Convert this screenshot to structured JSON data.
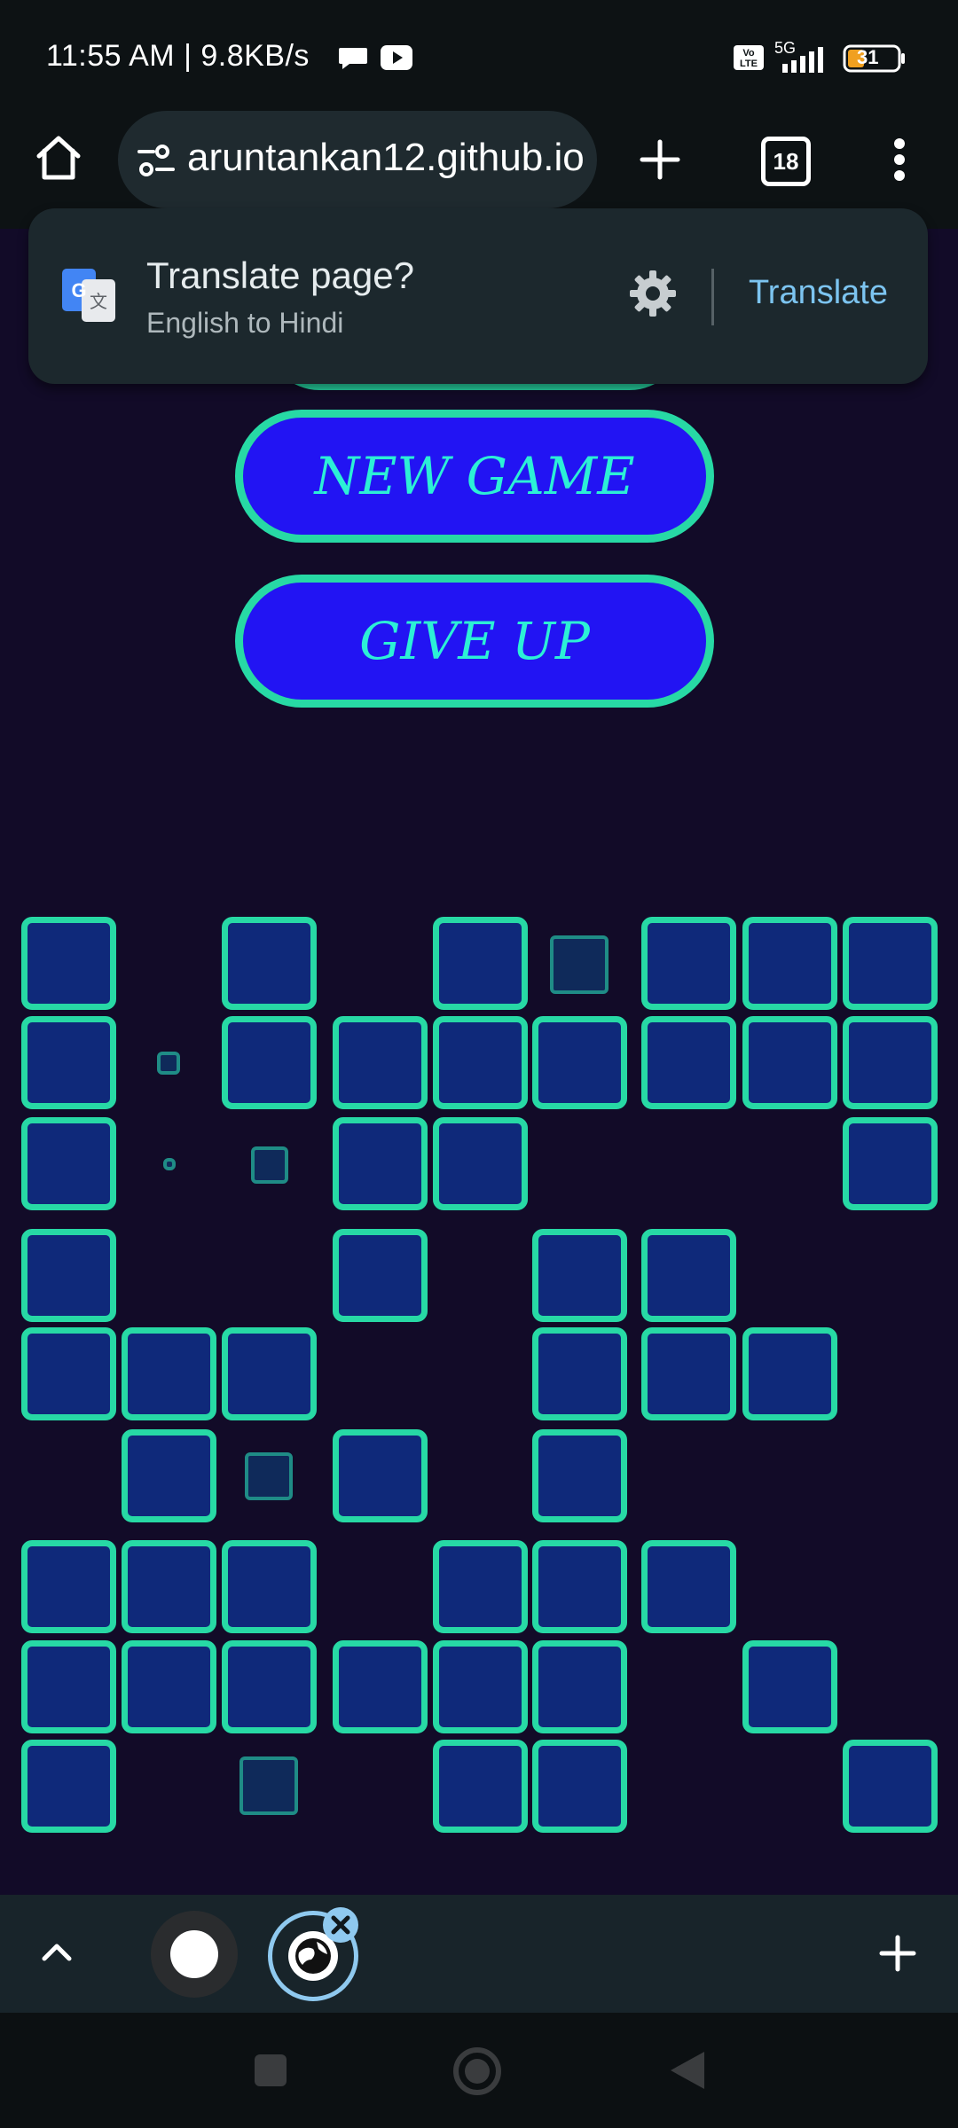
{
  "status_bar": {
    "time_speed": "11:55 AM | 9.8KB/s",
    "volte": "Vo LTE",
    "network": "5G",
    "battery": "31"
  },
  "browser": {
    "url": "aruntankan12.github.io",
    "tab_count": "18"
  },
  "translate_popup": {
    "title": "Translate page?",
    "subtitle": "English to Hindi",
    "action": "Translate"
  },
  "game": {
    "new_game_label": "NEW GAME",
    "give_up_label": "GIVE UP"
  },
  "colors": {
    "background": "#120b28",
    "cell_fill": "#0f297a",
    "cell_border": "#27d9a5",
    "button_fill": "#2214f3",
    "button_text": "#2cf0d6"
  }
}
